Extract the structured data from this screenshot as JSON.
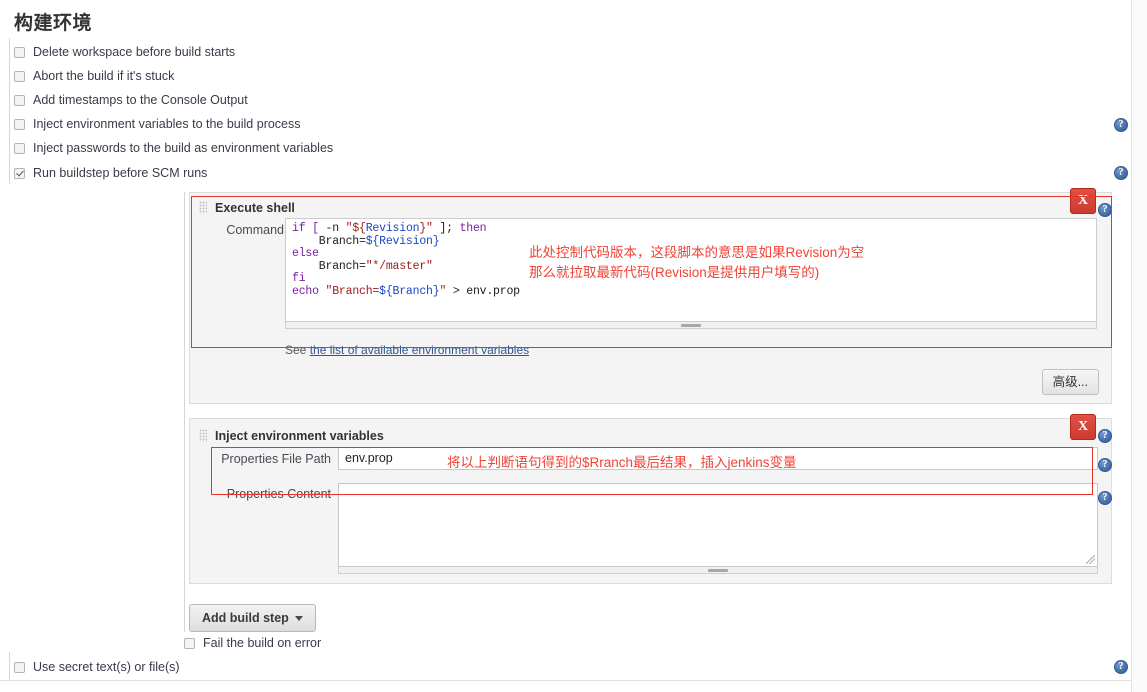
{
  "page": {
    "title": "构建环境"
  },
  "env_options": [
    {
      "label": "Delete workspace before build starts",
      "checked": false,
      "help": false
    },
    {
      "label": "Abort the build if it's stuck",
      "checked": false,
      "help": false
    },
    {
      "label": "Add timestamps to the Console Output",
      "checked": false,
      "help": false
    },
    {
      "label": "Inject environment variables to the build process",
      "checked": false,
      "help": true
    },
    {
      "label": "Inject passwords to the build as environment variables",
      "checked": false,
      "help": false
    },
    {
      "label": "Run buildstep before SCM runs",
      "checked": true,
      "help": true
    }
  ],
  "build_steps": [
    {
      "title": "Execute shell",
      "delete_label": "X",
      "command_label": "Command",
      "command_lines": [
        [
          {
            "t": "if [ ",
            "c": "k"
          },
          {
            "t": "-n ",
            "c": "p"
          },
          {
            "t": "\"${",
            "c": "s"
          },
          {
            "t": "Revision",
            "c": "v"
          },
          {
            "t": "}\"",
            "c": "s"
          },
          {
            "t": " ]; ",
            "c": "p"
          },
          {
            "t": "then",
            "c": "k"
          }
        ],
        [
          {
            "t": "    Branch=",
            "c": "p"
          },
          {
            "t": "${",
            "c": "v"
          },
          {
            "t": "Revision",
            "c": "v"
          },
          {
            "t": "}",
            "c": "v"
          }
        ],
        [
          {
            "t": "else",
            "c": "k"
          }
        ],
        [
          {
            "t": "    Branch=",
            "c": "p"
          },
          {
            "t": "\"*/master\"",
            "c": "s"
          }
        ],
        [
          {
            "t": "fi",
            "c": "k"
          }
        ],
        [
          {
            "t": "echo ",
            "c": "k"
          },
          {
            "t": "\"Branch=",
            "c": "s"
          },
          {
            "t": "${Branch}",
            "c": "v"
          },
          {
            "t": "\"",
            "c": "s"
          },
          {
            "t": " > env.prop",
            "c": "p"
          }
        ]
      ],
      "env_link_prefix": "See ",
      "env_link_text": "the list of available environment variables",
      "advanced_label": "高级...",
      "annotation": "此处控制代码版本，这段脚本的意思是如果Revision为空\n那么就拉取最新代码(Revision是提供用户填写的)"
    },
    {
      "title": "Inject environment variables",
      "delete_label": "X",
      "file_path_label": "Properties File Path",
      "file_path_value": "env.prop",
      "content_label": "Properties Content",
      "content_value": "",
      "annotation": "将以上判断语句得到的$Rranch最后结果，插入jenkins变量"
    }
  ],
  "footer": {
    "add_build_step": "Add build step",
    "fail_on_error": {
      "label": "Fail the build on error",
      "checked": false
    },
    "use_secret": {
      "label": "Use secret text(s) or file(s)",
      "checked": false
    }
  },
  "icons": {
    "help": "?"
  },
  "colors": {
    "annotation_red": "#f04337",
    "delete_red": "#cd3b2e",
    "link_blue": "#32558f"
  }
}
